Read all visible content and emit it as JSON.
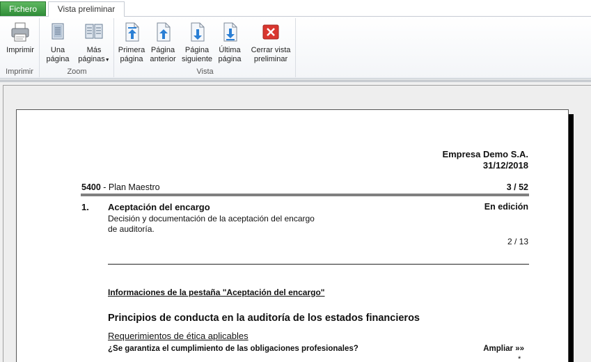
{
  "tabs": {
    "file": "Fichero",
    "preview": "Vista preliminar"
  },
  "ribbon": {
    "print_group": {
      "label": "Imprimir",
      "print_button": "Imprimir"
    },
    "zoom_group": {
      "label": "Zoom",
      "one_page_l1": "Una",
      "one_page_l2": "página",
      "more_pages_l1": "Más",
      "more_pages_l2": "páginas"
    },
    "view_group": {
      "label": "Vista",
      "first_l1": "Primera",
      "first_l2": "página",
      "prev_l1": "Página",
      "prev_l2": "anterior",
      "next_l1": "Página",
      "next_l2": "siguiente",
      "last_l1": "Última",
      "last_l2": "página",
      "close_l1": "Cerrar vista",
      "close_l2": "preliminar"
    }
  },
  "document": {
    "company": "Empresa Demo S.A.",
    "date": "31/12/2018",
    "plan_code": "5400",
    "plan_title": " - Plan Maestro",
    "page_indicator": "3 / 52",
    "section_number": "1.",
    "section_title": "Aceptación del encargo",
    "section_status": "En edición",
    "section_desc_l1": "Decisión y documentación de la aceptación del encargo",
    "section_desc_l2": "de auditoría.",
    "section_count": "2 / 13",
    "info_link": "Informaciones de la pestaña \"Aceptación del encargo\"",
    "principles_heading": "Principios de conducta en la auditoría de los estados financieros",
    "requirements": "Requerimientos de ética aplicables",
    "question": "¿Se garantiza el cumplimiento de las obligaciones profesionales?",
    "expand_link": "Ampliar »»",
    "asterisk": "*"
  },
  "colors": {
    "file_tab": "#3a9a44",
    "close_icon": "#d9362f",
    "arrow_icon": "#2b7fd4"
  }
}
